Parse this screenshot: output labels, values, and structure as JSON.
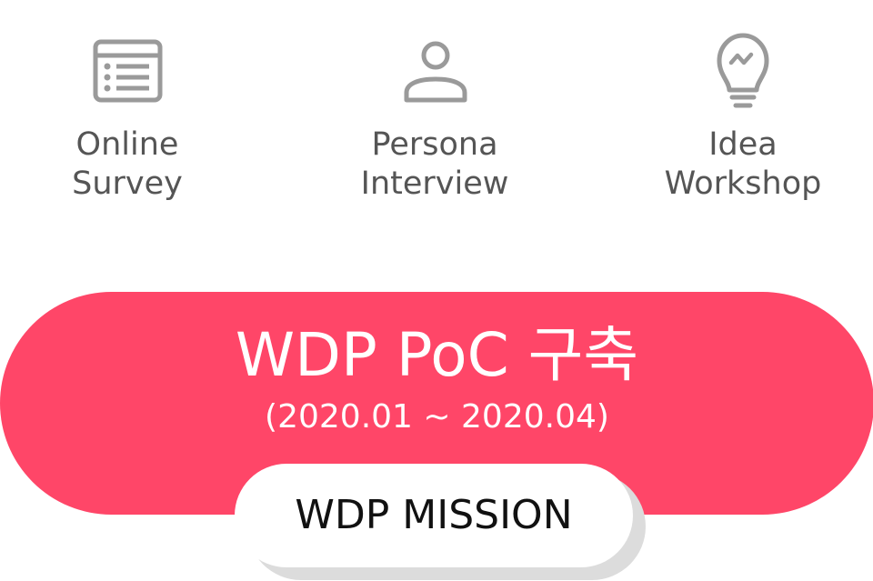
{
  "methods": [
    {
      "icon": "survey-list-icon",
      "line1": "Online",
      "line2": "Survey"
    },
    {
      "icon": "person-icon",
      "line1": "Persona",
      "line2": "Interview"
    },
    {
      "icon": "lightbulb-icon",
      "line1": "Idea",
      "line2": "Workshop"
    }
  ],
  "banner": {
    "title": "WDP PoC 구축",
    "period": "(2020.01 ~ 2020.04)"
  },
  "mission": {
    "label": "WDP MISSION"
  },
  "colors": {
    "accent": "#ff4668",
    "icon": "#9a9a9a",
    "label_text": "#555555"
  }
}
